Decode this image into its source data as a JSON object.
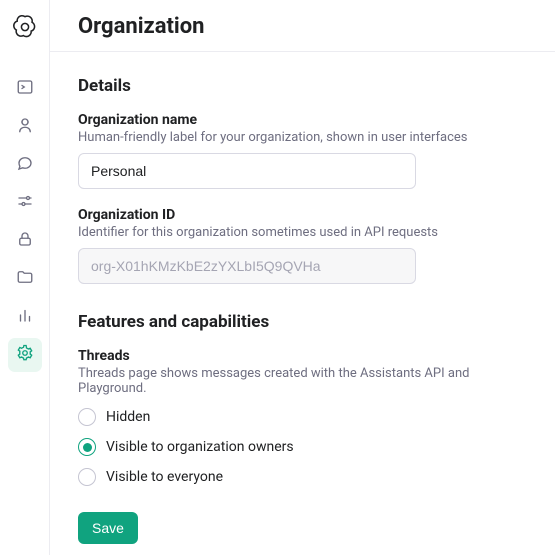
{
  "header": {
    "title": "Organization"
  },
  "sidebar": {
    "items": [
      {
        "name": "playground-icon"
      },
      {
        "name": "assistants-icon"
      },
      {
        "name": "chat-icon"
      },
      {
        "name": "tune-icon"
      },
      {
        "name": "api-keys-icon"
      },
      {
        "name": "files-icon"
      },
      {
        "name": "usage-icon"
      },
      {
        "name": "settings-icon"
      }
    ]
  },
  "details": {
    "section": "Details",
    "org_name": {
      "label": "Organization name",
      "desc": "Human-friendly label for your organization, shown in user interfaces",
      "value": "Personal"
    },
    "org_id": {
      "label": "Organization ID",
      "desc": "Identifier for this organization sometimes used in API requests",
      "value": "org-X01hKMzKbE2zYXLbI5Q9QVHa"
    }
  },
  "features": {
    "section": "Features and capabilities",
    "threads": {
      "label": "Threads",
      "desc": "Threads page shows messages created with the Assistants API and Playground.",
      "options": [
        {
          "label": "Hidden",
          "selected": false
        },
        {
          "label": "Visible to organization owners",
          "selected": true
        },
        {
          "label": "Visible to everyone",
          "selected": false
        }
      ]
    }
  },
  "actions": {
    "save": "Save"
  },
  "colors": {
    "accent": "#10a37f"
  }
}
